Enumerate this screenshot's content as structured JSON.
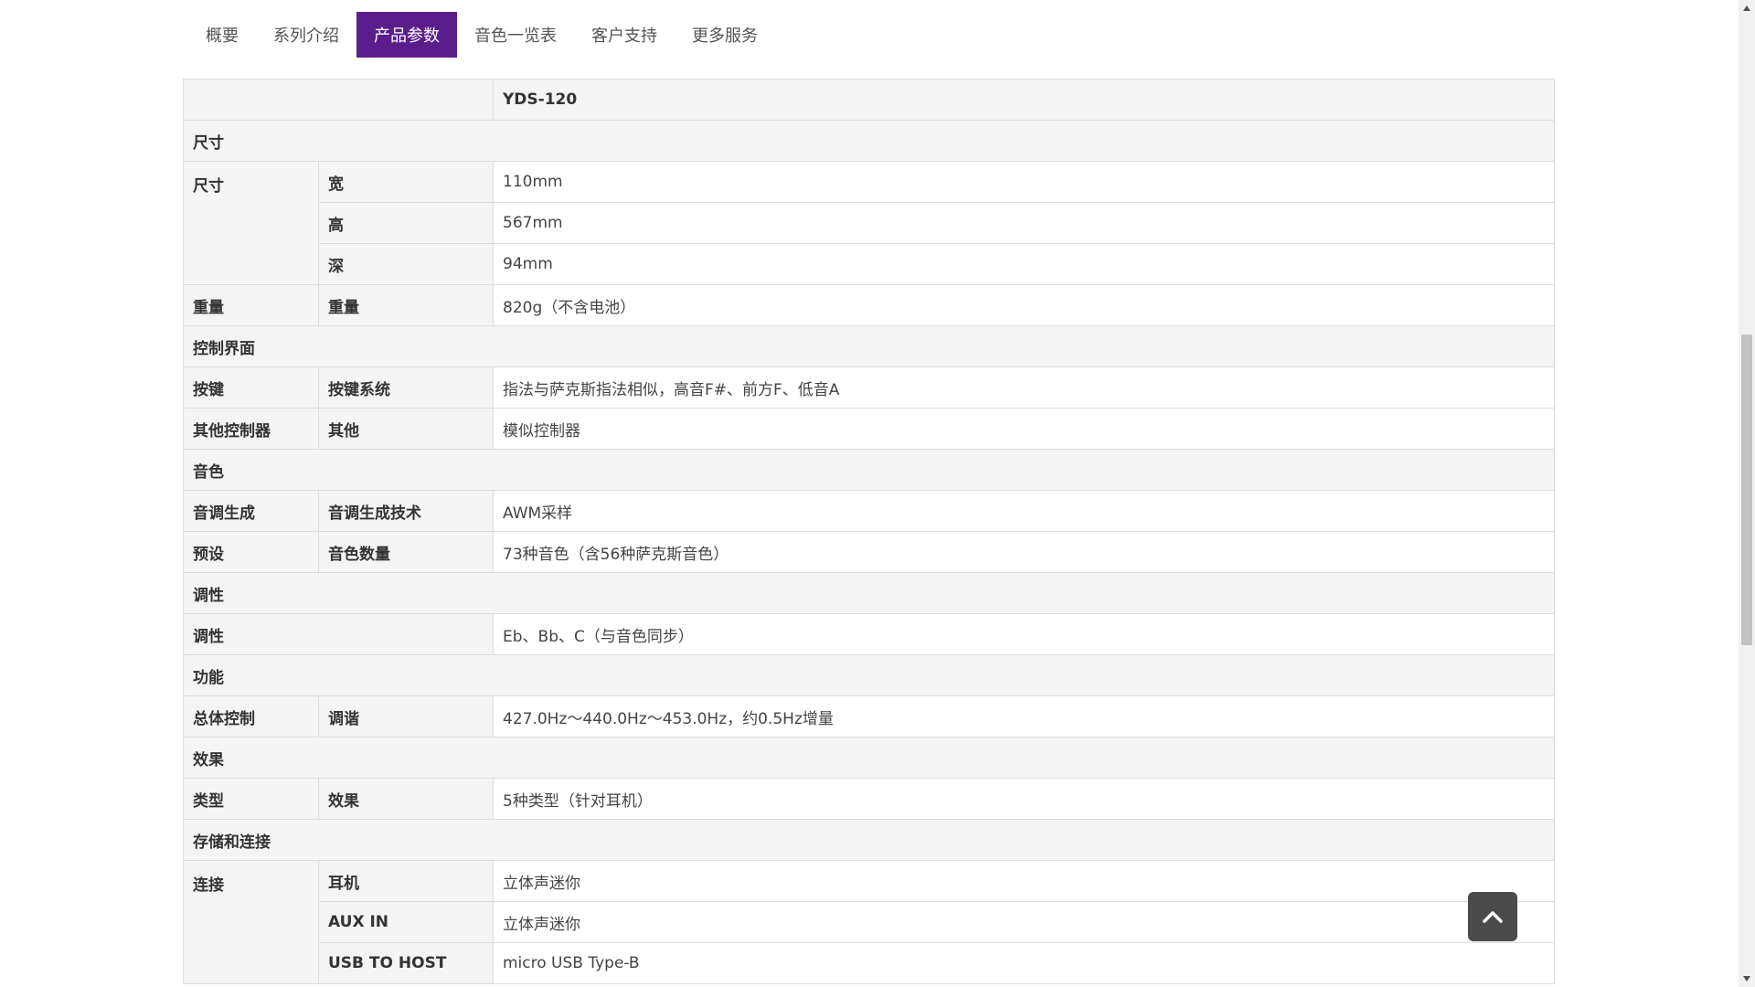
{
  "tabs": [
    {
      "label": "概要"
    },
    {
      "label": "系列介绍"
    },
    {
      "label": "产品参数",
      "active": true
    },
    {
      "label": "音色一览表"
    },
    {
      "label": "客户支持"
    },
    {
      "label": "更多服务"
    }
  ],
  "spec": {
    "model": "YDS-120",
    "sections": {
      "size": "尺寸",
      "control": "控制界面",
      "voice": "音色",
      "key": "调性",
      "function": "功能",
      "effect": "效果",
      "storage": "存储和连接"
    },
    "rows": {
      "size_group": "尺寸",
      "width_label": "宽",
      "width_value": "110mm",
      "height_label": "高",
      "height_value": "567mm",
      "depth_label": "深",
      "depth_value": "94mm",
      "weight_group": "重量",
      "weight_label": "重量",
      "weight_value": "820g（不含电池）",
      "keys_group": "按键",
      "keys_label": "按键系统",
      "keys_value": "指法与萨克斯指法相似，高音F#、前方F、低音A",
      "other_group": "其他控制器",
      "other_label": "其他",
      "other_value": "模似控制器",
      "tone_group": "音调生成",
      "tone_label": "音调生成技术",
      "tone_value": "AWM采样",
      "preset_group": "预设",
      "preset_label": "音色数量",
      "preset_value": "73种音色（含56种萨克斯音色）",
      "key_group": "调性",
      "key_value": "Eb、Bb、C（与音色同步）",
      "master_group": "总体控制",
      "tuning_label": "调谐",
      "tuning_value": "427.0Hz～440.0Hz～453.0Hz，约0.5Hz增量",
      "effect_group": "类型",
      "effect_label": "效果",
      "effect_value": "5种类型（针对耳机）",
      "conn_group": "连接",
      "headphone_label": "耳机",
      "headphone_value": "立体声迷你",
      "aux_label": "AUX IN",
      "aux_value": "立体声迷你",
      "usb_label": "USB TO HOST",
      "usb_value": "micro USB Type-B"
    }
  },
  "icons": {
    "back_to_top": "chevron-up-icon",
    "scroll_up": "triangle-up-icon",
    "scroll_down": "triangle-down-icon"
  },
  "colors": {
    "accent": "#5a1e8c",
    "header_bg": "#f4f4f4",
    "border": "#dcdcdc",
    "button_bg": "#4a4a4a"
  }
}
